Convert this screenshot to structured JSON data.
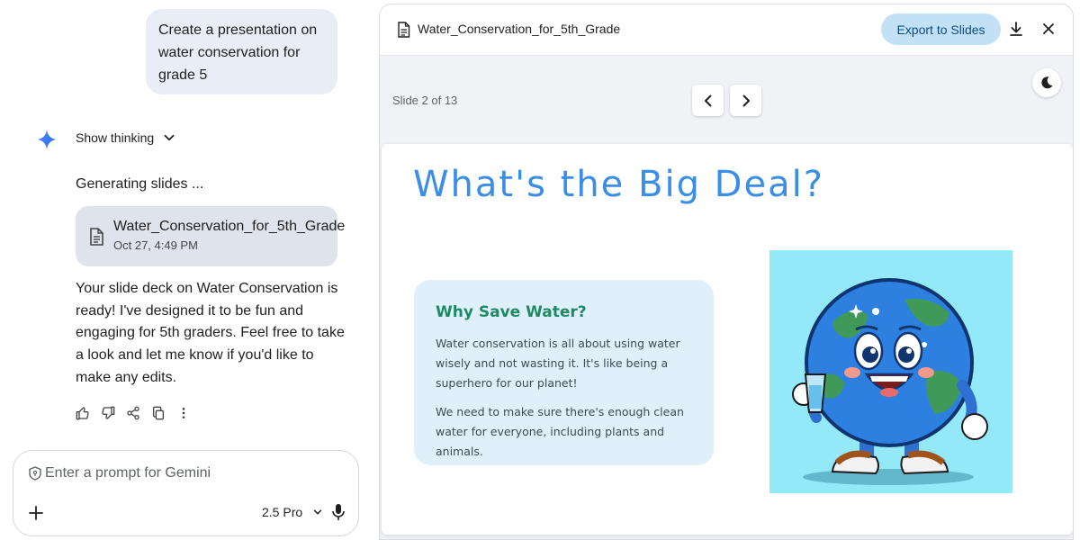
{
  "chat": {
    "user_message": "Create a presentation on water conservation for grade 5",
    "show_thinking_label": "Show thinking",
    "status_text": "Generating slides ...",
    "file_card": {
      "name": "Water_Conservation_for_5th_Grade",
      "date": "Oct 27, 4:49 PM"
    },
    "response_text": "Your slide deck on Water Conservation is ready! I've designed it to be fun and engaging for 5th graders. Feel free to take a look and let me know if you'd like to make any edits.",
    "actions": [
      "thumb-up-icon",
      "thumb-down-icon",
      "share-icon",
      "copy-icon",
      "more-vert-icon"
    ]
  },
  "prompt": {
    "placeholder": "Enter a prompt for Gemini",
    "model_label": "2.5 Pro"
  },
  "canvas": {
    "title": "Water_Conservation_for_5th_Grade",
    "export_label": "Export to Slides",
    "slide_counter": "Slide 2 of 13"
  },
  "slide": {
    "title": "What's the Big Deal?",
    "card_heading": "Why Save Water?",
    "paragraph_1": "Water conservation is all about using water wisely and not wasting it. It's like being a superhero for our planet!",
    "paragraph_2": "We need to make sure there's enough clean water for everyone, including plants and animals."
  },
  "colors": {
    "slide_title": "#3a8ee6",
    "card_heading": "#1e8a64",
    "card_bg": "#dff0fb",
    "illustration_bg": "#94e9f8",
    "export_button": "#c2e1f7",
    "user_bubble": "#e9eef6"
  }
}
